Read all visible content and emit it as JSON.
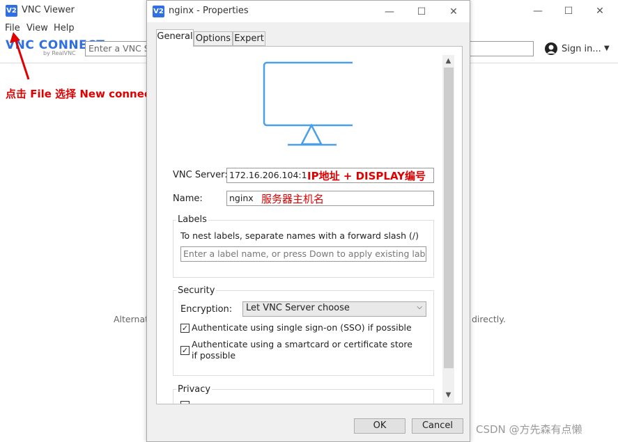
{
  "main": {
    "title": "VNC Viewer",
    "menu": [
      "File",
      "View",
      "Help"
    ],
    "brand": "VNC CONNECT",
    "brand_sub": "by RealVNC",
    "search_placeholder": "Enter a VNC Se",
    "signin": "Sign in...",
    "hint_left": "Alternat",
    "hint_right": "directly."
  },
  "annotations": {
    "file_hint": "点击 File 选择 New connection",
    "server_hint": "IP地址 + DISPLAY编号",
    "name_hint": "服务器主机名"
  },
  "dialog": {
    "title": "nginx - Properties",
    "tabs": [
      "General",
      "Options",
      "Expert"
    ],
    "vnc_server_label": "VNC Server:",
    "vnc_server_value": "172.16.206.104:1",
    "name_label": "Name:",
    "name_value": "nginx",
    "labels": {
      "title": "Labels",
      "hint": "To nest labels, separate names with a forward slash (/)",
      "placeholder": "Enter a label name, or press Down to apply existing labels"
    },
    "security": {
      "title": "Security",
      "encryption_label": "Encryption:",
      "encryption_value": "Let VNC Server choose",
      "sso_label": "Authenticate using single sign-on (SSO) if possible",
      "sso_checked": true,
      "smartcard_label": "Authenticate using a smartcard or certificate store if possible",
      "smartcard_checked": true
    },
    "privacy": {
      "title": "Privacy"
    },
    "ok": "OK",
    "cancel": "Cancel"
  },
  "watermark": "CSDN @方先森有点懒",
  "colors": {
    "brand_blue": "#2f6fe0",
    "annotation_red": "#e00000",
    "monitor_blue": "#4a9fe8"
  }
}
